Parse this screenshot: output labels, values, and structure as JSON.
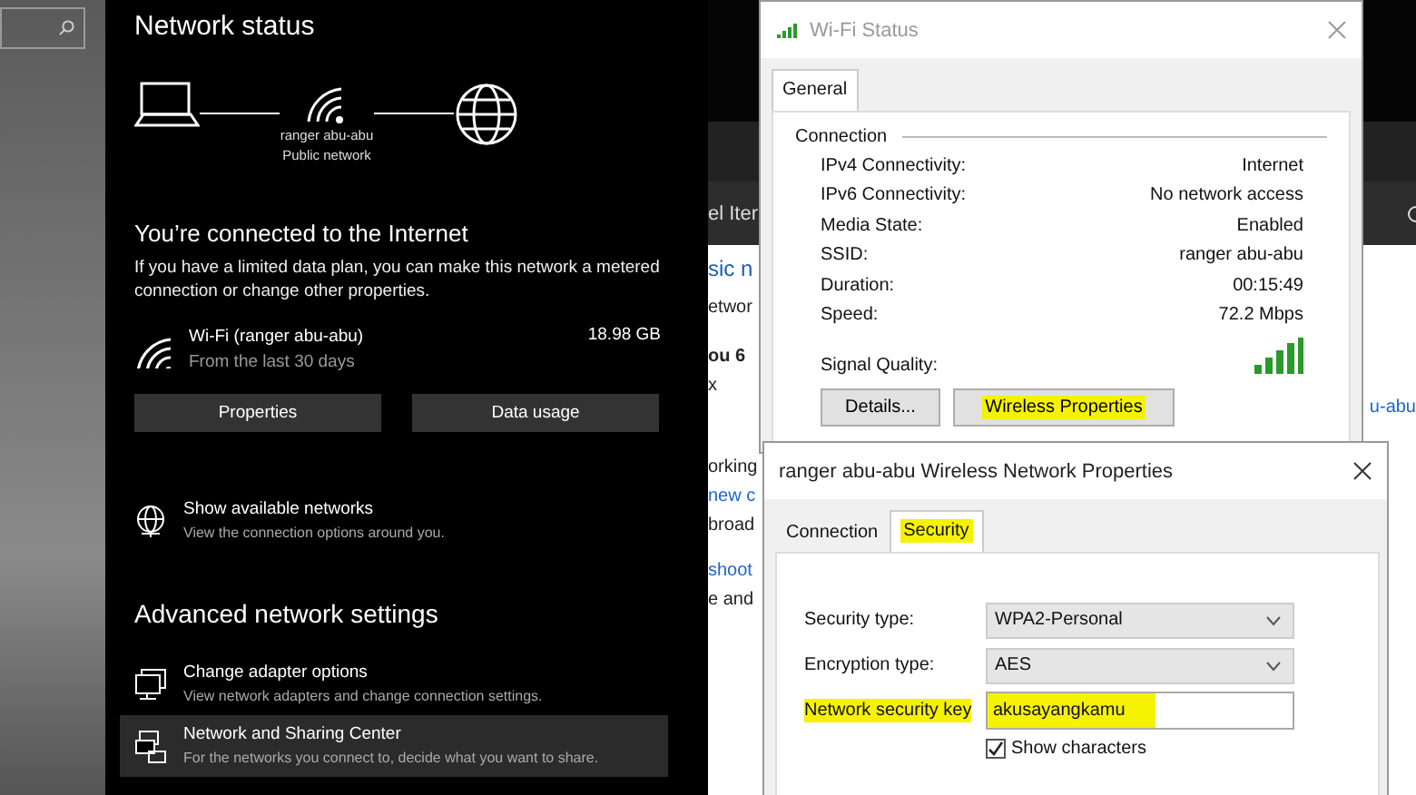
{
  "settings": {
    "title": "Network status",
    "diagram": {
      "network_name": "ranger abu-abu",
      "network_type": "Public network"
    },
    "connection_heading": "You’re connected to the Internet",
    "connection_text": "If you have a limited data plan, you can make this network a metered connection or change other properties.",
    "usage": {
      "name": "Wi-Fi (ranger abu-abu)",
      "period": "From the last 30 days",
      "amount": "18.98 GB"
    },
    "buttons": [
      "Properties",
      "Data usage"
    ],
    "show_networks": {
      "title": "Show available networks",
      "subtitle": "View the connection options around you.",
      "selected": false
    },
    "advanced_heading": "Advanced network settings",
    "advanced_items": [
      {
        "kind": "adapter",
        "title": "Change adapter options",
        "subtitle": "View network adapters and change connection settings.",
        "selected": false
      },
      {
        "kind": "sharing",
        "title": "Network and Sharing Center",
        "subtitle": "For the networks you connect to, decide what you want to share.",
        "selected": true
      }
    ]
  },
  "background_window": {
    "toolbar_text": "el Iter",
    "fragments": [
      {
        "kind": "heading",
        "text": "sic n"
      },
      {
        "kind": "text",
        "text": "etwor"
      },
      {
        "kind": "bold",
        "text": "ou 6"
      },
      {
        "kind": "text",
        "text": "x"
      },
      {
        "kind": "text",
        "text": "orking"
      },
      {
        "kind": "link",
        "text": "new c"
      },
      {
        "kind": "text",
        "text": "broad"
      },
      {
        "kind": "link",
        "text": "shoot"
      },
      {
        "kind": "text",
        "text": "e and"
      }
    ],
    "right_link": "u-abu"
  },
  "wifi_status": {
    "title": "Wi-Fi Status",
    "tabs": [
      {
        "label": "General",
        "selected": true
      }
    ],
    "group": "Connection",
    "rows": [
      {
        "label": "IPv4 Connectivity:",
        "value": "Internet"
      },
      {
        "label": "IPv6 Connectivity:",
        "value": "No network access"
      },
      {
        "label": "Media State:",
        "value": "Enabled"
      },
      {
        "label": "SSID:",
        "value": "ranger abu-abu"
      },
      {
        "label": "Duration:",
        "value": "00:15:49"
      },
      {
        "label": "Speed:",
        "value": "72.2 Mbps"
      }
    ],
    "signal_label": "Signal Quality:",
    "buttons": [
      {
        "label": "Details...",
        "highlighted": false
      },
      {
        "label": "Wireless Properties",
        "highlighted": true
      }
    ]
  },
  "properties": {
    "title": "ranger abu-abu Wireless Network Properties",
    "tabs": [
      {
        "label": "Connection",
        "selected": false,
        "highlighted": false
      },
      {
        "label": "Security",
        "selected": true,
        "highlighted": true
      }
    ],
    "fields": [
      {
        "kind": "select",
        "label": "Security type:",
        "value": "WPA2-Personal",
        "highlighted": false
      },
      {
        "kind": "select",
        "label": "Encryption type:",
        "value": "AES",
        "highlighted": false
      },
      {
        "kind": "text",
        "label": "Network security key",
        "value": "akusayangkamu",
        "highlighted": true
      }
    ],
    "show_characters": {
      "label": "Show characters",
      "checked": true
    }
  }
}
